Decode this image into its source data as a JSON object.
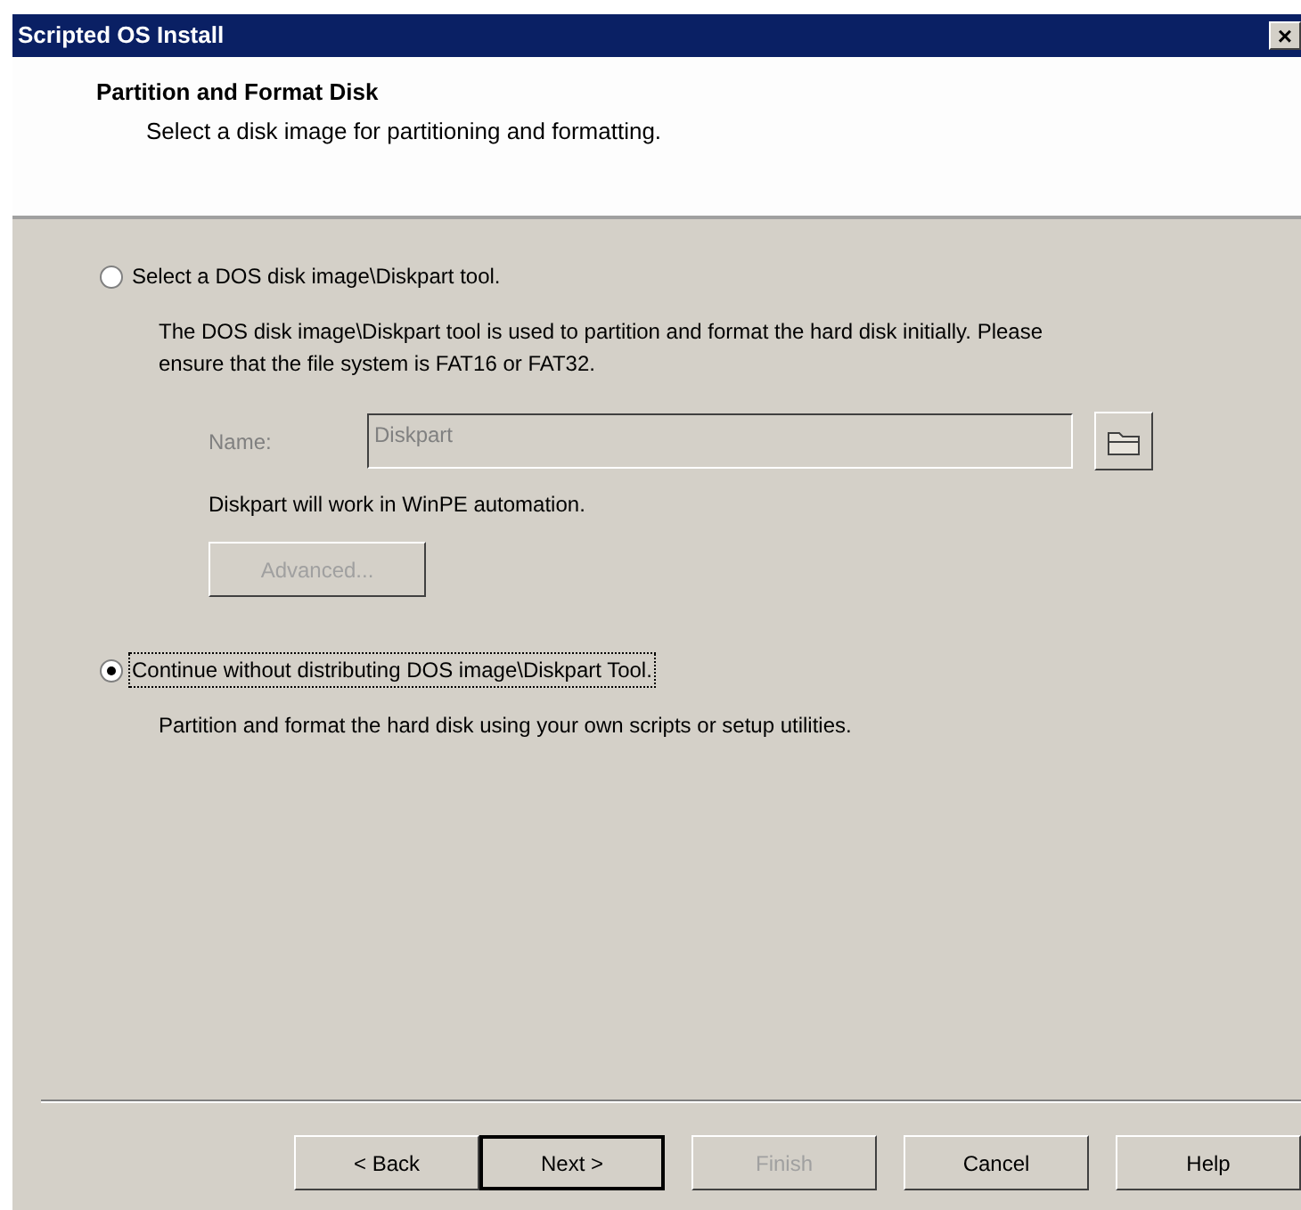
{
  "window": {
    "title": "Scripted OS Install",
    "close": "×"
  },
  "header": {
    "title": "Partition and Format Disk",
    "subtitle": "Select a disk image for partitioning and formatting."
  },
  "options": [
    {
      "label": "Select a DOS disk image\\Diskpart tool.",
      "selected": false,
      "focused": false,
      "description": "The DOS disk image\\Diskpart tool is used to partition and format the hard disk initially.  Please ensure that the file system is FAT16 or FAT32.",
      "name_label": "Name:",
      "name_value": "Diskpart",
      "disabled": true,
      "note": "Diskpart will work in WinPE automation.",
      "advanced": "Advanced..."
    },
    {
      "label": "Continue without distributing DOS image\\Diskpart Tool.",
      "selected": true,
      "focused": true,
      "description": "Partition and format the hard disk using your own scripts or setup utilities."
    }
  ],
  "buttons": [
    {
      "label": "< Back",
      "disabled": false,
      "default": false
    },
    {
      "label": "Next >",
      "disabled": false,
      "default": true
    },
    {
      "label": "Finish",
      "disabled": true,
      "default": false
    },
    {
      "label": "Cancel",
      "disabled": false,
      "default": false
    },
    {
      "label": "Help",
      "disabled": false,
      "default": false
    }
  ]
}
